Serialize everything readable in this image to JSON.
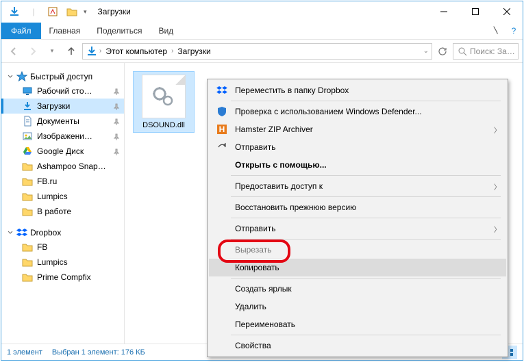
{
  "titlebar": {
    "title": "Загрузки"
  },
  "ribbon": {
    "file": "Файл",
    "tabs": [
      "Главная",
      "Поделиться",
      "Вид"
    ]
  },
  "address": {
    "segments": [
      "Этот компьютер",
      "Загрузки"
    ]
  },
  "search": {
    "placeholder": "Поиск: За…"
  },
  "sidebar": {
    "quick": {
      "label": "Быстрый доступ",
      "items": [
        {
          "label": "Рабочий сто…",
          "icon": "desktop",
          "pinned": true
        },
        {
          "label": "Загрузки",
          "icon": "downloads",
          "pinned": true,
          "selected": true
        },
        {
          "label": "Документы",
          "icon": "documents",
          "pinned": true
        },
        {
          "label": "Изображени…",
          "icon": "pictures",
          "pinned": true
        },
        {
          "label": "Google Диск",
          "icon": "gdrive",
          "pinned": true
        },
        {
          "label": "Ashampoo Snap…",
          "icon": "folder",
          "pinned": false
        },
        {
          "label": "FB.ru",
          "icon": "folder",
          "pinned": false
        },
        {
          "label": "Lumpics",
          "icon": "folder",
          "pinned": false
        },
        {
          "label": "В работе",
          "icon": "folder",
          "pinned": false
        }
      ]
    },
    "dropbox": {
      "label": "Dropbox",
      "items": [
        {
          "label": "FB",
          "icon": "folder"
        },
        {
          "label": "Lumpics",
          "icon": "folder"
        },
        {
          "label": "Prime Compfix",
          "icon": "folder"
        }
      ]
    }
  },
  "content": {
    "file": {
      "name": "DSOUND.dll"
    }
  },
  "context_menu": {
    "items": [
      {
        "label": "Переместить в папку Dropbox",
        "icon": "dropbox",
        "sub": false
      },
      {
        "sep": true
      },
      {
        "label": "Проверка с использованием Windows Defender...",
        "icon": "defender",
        "sub": false
      },
      {
        "label": "Hamster ZIP Archiver",
        "icon": "hamster",
        "sub": true
      },
      {
        "label": "Отправить",
        "icon": "share",
        "sub": false
      },
      {
        "label": "Открыть с помощью...",
        "bold": true
      },
      {
        "sep": true
      },
      {
        "label": "Предоставить доступ к",
        "sub": true
      },
      {
        "sep": true
      },
      {
        "label": "Восстановить прежнюю версию"
      },
      {
        "sep": true
      },
      {
        "label": "Отправить",
        "sub": true
      },
      {
        "sep": true
      },
      {
        "label": "Вырезать",
        "cut": true
      },
      {
        "label": "Копировать",
        "hover": true
      },
      {
        "sep": true
      },
      {
        "label": "Создать ярлык"
      },
      {
        "label": "Удалить"
      },
      {
        "label": "Переименовать"
      },
      {
        "sep": true
      },
      {
        "label": "Свойства"
      }
    ]
  },
  "status": {
    "count": "1 элемент",
    "selection": "Выбран 1 элемент: 176 КБ"
  }
}
